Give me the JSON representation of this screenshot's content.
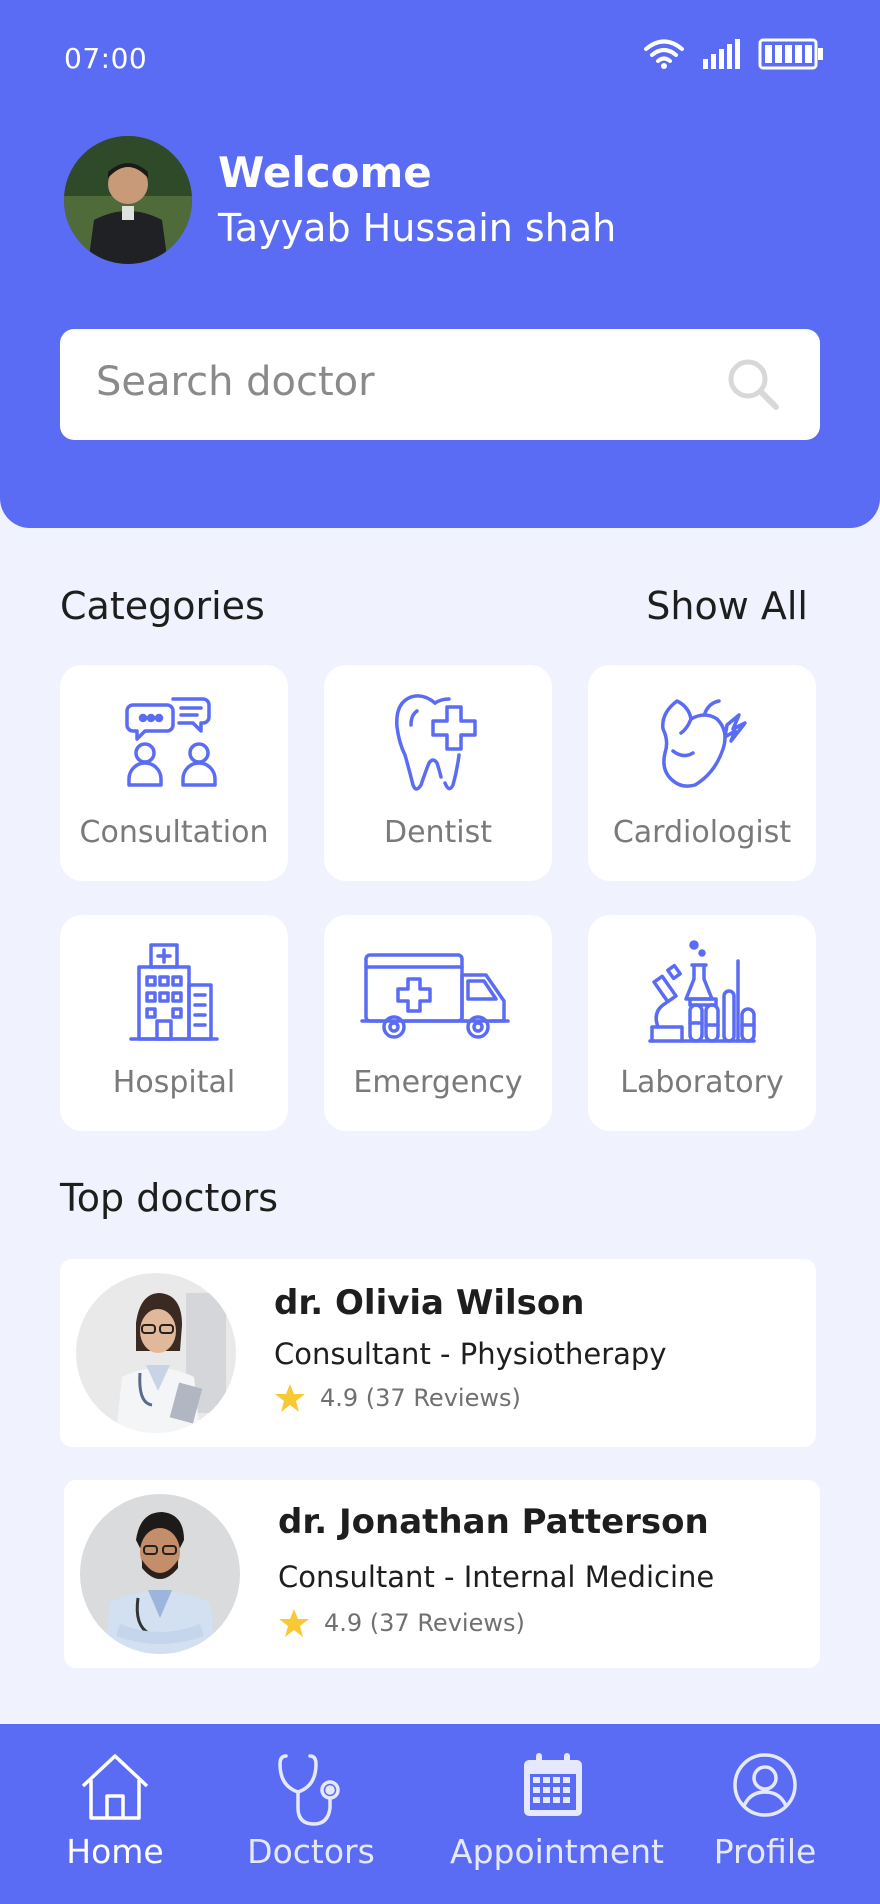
{
  "status_bar": {
    "time": "07:00"
  },
  "header": {
    "welcome": "Welcome",
    "user_name": "Tayyab Hussain shah"
  },
  "search": {
    "placeholder": "Search doctor"
  },
  "categories": {
    "title": "Categories",
    "show_all": "Show All",
    "items": [
      {
        "label": "Consultation",
        "icon": "consultation-icon"
      },
      {
        "label": "Dentist",
        "icon": "tooth-icon"
      },
      {
        "label": "Cardiologist",
        "icon": "heart-icon"
      },
      {
        "label": "Hospital",
        "icon": "hospital-icon"
      },
      {
        "label": "Emergency",
        "icon": "ambulance-icon"
      },
      {
        "label": "Laboratory",
        "icon": "lab-icon"
      }
    ]
  },
  "top_doctors": {
    "title": "Top doctors",
    "items": [
      {
        "name": "dr. Olivia Wilson",
        "specialty": "Consultant - Physiotherapy",
        "rating": "4.9 (37 Reviews)"
      },
      {
        "name": "dr. Jonathan Patterson",
        "specialty": "Consultant - Internal Medicine",
        "rating": "4.9 (37 Reviews)"
      }
    ]
  },
  "bottom_nav": {
    "items": [
      {
        "label": "Home",
        "icon": "home-icon",
        "active": true
      },
      {
        "label": "Doctors",
        "icon": "stethoscope-icon",
        "active": false
      },
      {
        "label": "Appointment",
        "icon": "calendar-icon",
        "active": false
      },
      {
        "label": "Profile",
        "icon": "profile-icon",
        "active": false
      }
    ]
  },
  "colors": {
    "primary": "#5a6cf3",
    "background": "#f0f3fd",
    "star": "#f7c934"
  }
}
